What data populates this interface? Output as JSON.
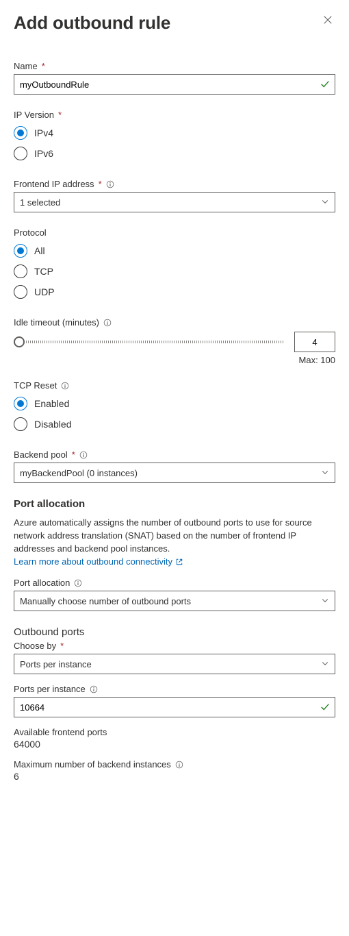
{
  "header": {
    "title": "Add outbound rule"
  },
  "name": {
    "label": "Name",
    "value": "myOutboundRule"
  },
  "ipVersion": {
    "label": "IP Version",
    "options": [
      "IPv4",
      "IPv6"
    ],
    "selected": "IPv4"
  },
  "frontendIp": {
    "label": "Frontend IP address",
    "value": "1 selected"
  },
  "protocol": {
    "label": "Protocol",
    "options": [
      "All",
      "TCP",
      "UDP"
    ],
    "selected": "All"
  },
  "idleTimeout": {
    "label": "Idle timeout (minutes)",
    "value": "4",
    "maxLabel": "Max: 100"
  },
  "tcpReset": {
    "label": "TCP Reset",
    "options": [
      "Enabled",
      "Disabled"
    ],
    "selected": "Enabled"
  },
  "backendPool": {
    "label": "Backend pool",
    "value": "myBackendPool (0 instances)"
  },
  "portAllocation": {
    "sectionTitle": "Port allocation",
    "description": "Azure automatically assigns the number of outbound ports to use for source network address translation (SNAT) based on the number of frontend IP addresses and backend pool instances.",
    "linkText": "Learn more about outbound connectivity",
    "fieldLabel": "Port allocation",
    "fieldValue": "Manually choose number of outbound ports"
  },
  "outboundPorts": {
    "title": "Outbound ports",
    "chooseByLabel": "Choose by",
    "chooseByValue": "Ports per instance",
    "portsPerInstanceLabel": "Ports per instance",
    "portsPerInstanceValue": "10664",
    "availablePortsLabel": "Available frontend ports",
    "availablePortsValue": "64000",
    "maxBackendLabel": "Maximum number of backend instances",
    "maxBackendValue": "6"
  }
}
